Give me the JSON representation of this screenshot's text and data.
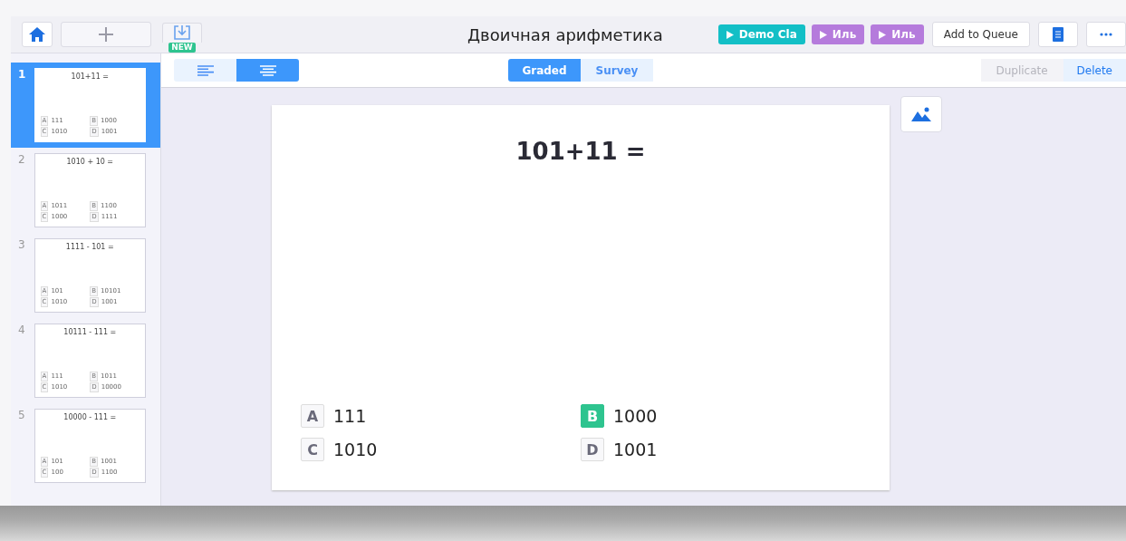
{
  "toolbar": {
    "new_badge": "NEW",
    "title": "Двоичная арифметика",
    "play_buttons": [
      {
        "label": "Demo Cla",
        "color": "#13bfc6"
      },
      {
        "label": "Иль",
        "color": "#b57bdc"
      },
      {
        "label": "Иль",
        "color": "#b57bdc"
      }
    ],
    "queue_button": "Add to Queue"
  },
  "align_buttons": [
    {
      "kind": "left",
      "selected": false
    },
    {
      "kind": "center",
      "selected": true
    }
  ],
  "mode_tabs": [
    {
      "label": "Graded",
      "selected": true
    },
    {
      "label": "Survey",
      "selected": false
    }
  ],
  "actions": [
    {
      "label": "Duplicate",
      "disabled": true
    },
    {
      "label": "Delete",
      "disabled": false
    }
  ],
  "slides": [
    {
      "number": "1",
      "selected": true,
      "question": "101+11 =",
      "choices": [
        {
          "letter": "A",
          "text": "111"
        },
        {
          "letter": "B",
          "text": "1000"
        },
        {
          "letter": "C",
          "text": "1010"
        },
        {
          "letter": "D",
          "text": "1001"
        }
      ]
    },
    {
      "number": "2",
      "selected": false,
      "question": "1010 + 10 =",
      "choices": [
        {
          "letter": "A",
          "text": "1011"
        },
        {
          "letter": "B",
          "text": "1100"
        },
        {
          "letter": "C",
          "text": "1000"
        },
        {
          "letter": "D",
          "text": "1111"
        }
      ]
    },
    {
      "number": "3",
      "selected": false,
      "question": "1111 - 101 =",
      "choices": [
        {
          "letter": "A",
          "text": "101"
        },
        {
          "letter": "B",
          "text": "10101"
        },
        {
          "letter": "C",
          "text": "1010"
        },
        {
          "letter": "D",
          "text": "1001"
        }
      ]
    },
    {
      "number": "4",
      "selected": false,
      "question": "10111 - 111 =",
      "choices": [
        {
          "letter": "A",
          "text": "111"
        },
        {
          "letter": "B",
          "text": "1011"
        },
        {
          "letter": "C",
          "text": "1010"
        },
        {
          "letter": "D",
          "text": "10000"
        }
      ]
    },
    {
      "number": "5",
      "selected": false,
      "question": "10000 - 111 =",
      "choices": [
        {
          "letter": "A",
          "text": "101"
        },
        {
          "letter": "B",
          "text": "1001"
        },
        {
          "letter": "C",
          "text": "100"
        },
        {
          "letter": "D",
          "text": "1100"
        }
      ]
    }
  ],
  "editor": {
    "question": "101+11 =",
    "choices": [
      {
        "letter": "A",
        "text": "111",
        "correct": false
      },
      {
        "letter": "B",
        "text": "1000",
        "correct": true
      },
      {
        "letter": "C",
        "text": "1010",
        "correct": false
      },
      {
        "letter": "D",
        "text": "1001",
        "correct": false
      }
    ]
  }
}
